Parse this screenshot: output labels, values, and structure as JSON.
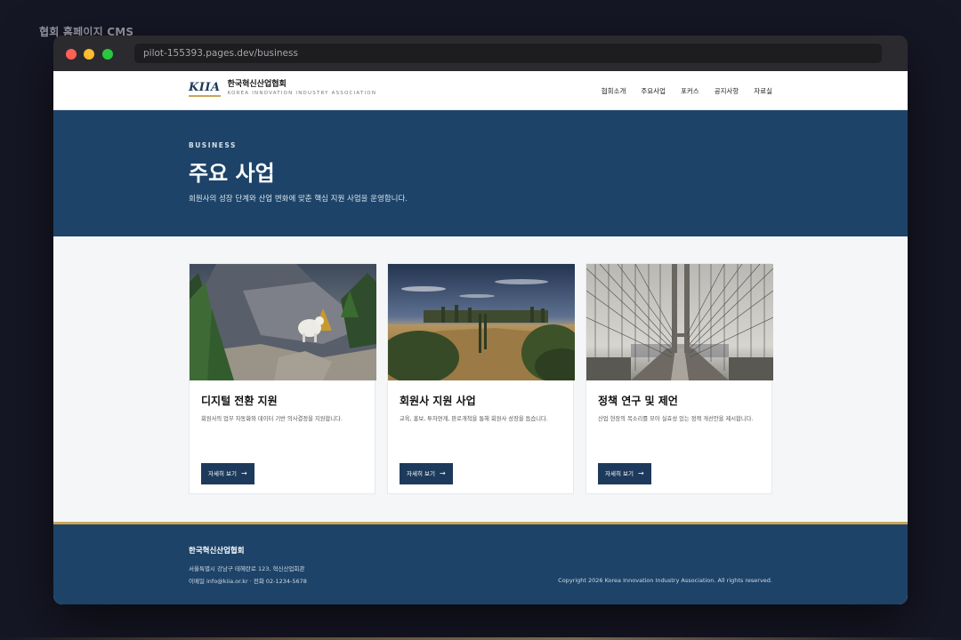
{
  "app": {
    "title": "협회 홈페이지 CMS"
  },
  "browser": {
    "url": "pilot-155393.pages.dev/business"
  },
  "header": {
    "logo_mark": "KIIA",
    "logo_name": "한국혁신산업협회",
    "logo_sub": "KOREA INNOVATION INDUSTRY ASSOCIATION",
    "nav": [
      "협회소개",
      "주요사업",
      "포커스",
      "공지사항",
      "자료실"
    ]
  },
  "hero": {
    "eyebrow": "BUSINESS",
    "title": "주요 사업",
    "desc": "회원사의 성장 단계와 산업 변화에 맞춘 핵심 지원 사업을 운영합니다."
  },
  "cards": [
    {
      "title": "디지털 전환 지원",
      "desc": "회원사의 업무 자동화와 데이터 기반 의사결정을 지원합니다.",
      "button": "자세히 보기",
      "image": "mountain-goat-photo"
    },
    {
      "title": "회원사 지원 사업",
      "desc": "교육, 홍보, 투자연계, 판로개척을 통해 회원사 성장을 돕습니다.",
      "button": "자세히 보기",
      "image": "tuscany-landscape-photo"
    },
    {
      "title": "정책 연구 및 제언",
      "desc": "산업 현장의 목소리를 모아 실효성 있는 정책 개선안을 제시합니다.",
      "button": "자세히 보기",
      "image": "bridge-photo"
    }
  ],
  "footer": {
    "name": "한국혁신산업협회",
    "address": "서울특별시 강남구 테헤란로 123, 혁신산업회관",
    "contact": "이메일 info@kiia.or.kr · 전화 02-1234-5678",
    "copyright": "Copyright 2026 Korea Innovation Industry Association. All rights reserved."
  },
  "colors": {
    "primary": "#1d4368",
    "accent": "#c9a45a",
    "button": "#1d3a5c"
  }
}
